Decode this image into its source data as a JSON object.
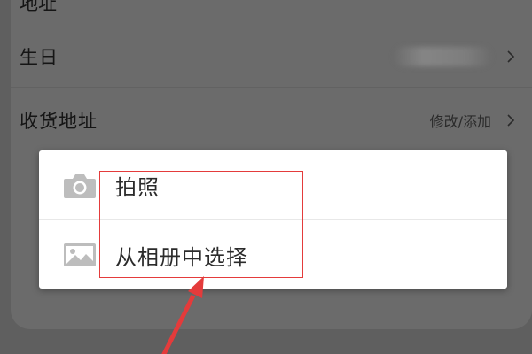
{
  "profile_rows": {
    "top_partial_label": "地址",
    "birthday_label": "生日",
    "address_label": "收货地址",
    "address_value": "修改/添加"
  },
  "photo_sheet": {
    "take_photo_label": "拍照",
    "choose_from_album_label": "从相册中选择"
  },
  "icons": {
    "camera": "camera-icon",
    "gallery": "image-icon",
    "chevron": "chevron-right-icon"
  },
  "colors": {
    "overlay_background": "#5f5f5f",
    "sheet_background": "#ffffff",
    "annotation_red": "#e43b3b",
    "icon_gray": "#bdbdbd"
  }
}
